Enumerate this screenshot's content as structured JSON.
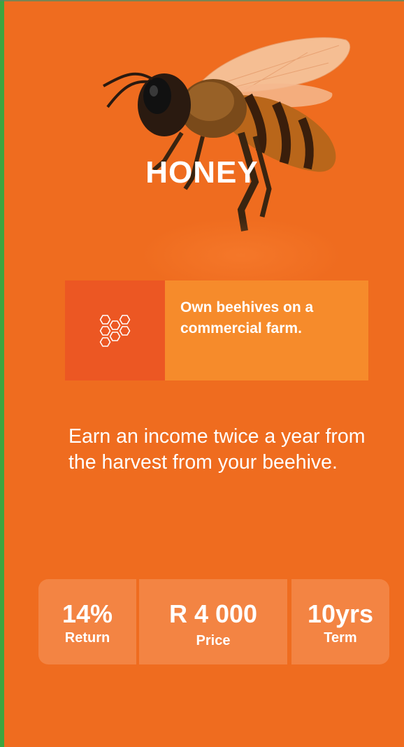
{
  "product": {
    "title": "HONEY",
    "feature_text": "Own beehives on a commercial farm.",
    "description": "Earn an income twice a year from the harvest from your beehive.",
    "icons": {
      "hero": "bee-image",
      "feature": "honeycomb-icon"
    }
  },
  "stats": [
    {
      "value": "14%",
      "label": "Return"
    },
    {
      "value": "R 4 000",
      "label": "Price"
    },
    {
      "value": "10yrs",
      "label": "Term"
    }
  ],
  "colors": {
    "background": "#ef6c1f",
    "feature_icon_bg": "#ec5723",
    "feature_text_bg": "#f68b2b",
    "stat_bg": "#f38443",
    "accent_stripe": "#3da53f"
  }
}
